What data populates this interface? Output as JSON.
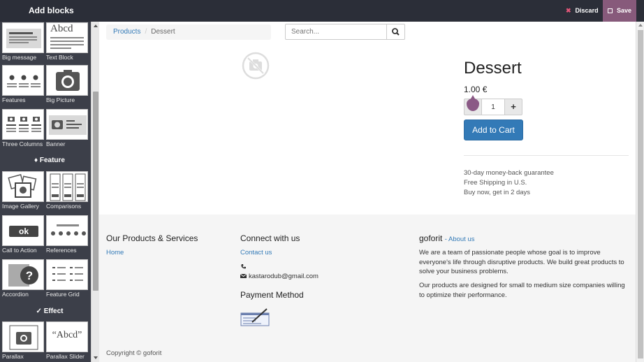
{
  "sidebar": {
    "title": "Add blocks",
    "snippets": [
      {
        "label": "Big message"
      },
      {
        "label": "Text Block"
      },
      {
        "label": "Features"
      },
      {
        "label": "Big Picture"
      },
      {
        "label": "Three Columns"
      },
      {
        "label": "Banner"
      },
      {
        "label": "Image Gallery"
      },
      {
        "label": "Comparisons"
      },
      {
        "label": "Call to Action"
      },
      {
        "label": "References"
      },
      {
        "label": "Accordion"
      },
      {
        "label": "Feature Grid"
      },
      {
        "label": "Parallax"
      },
      {
        "label": "Parallax Slider"
      }
    ],
    "sections": {
      "feature": "Feature",
      "effect": "Effect"
    },
    "thumb_text": {
      "text_block": "Abcd",
      "call_to_action": "ok",
      "parallax_slider": "Abcd"
    }
  },
  "toolbar": {
    "discard": "Discard",
    "save": "Save"
  },
  "breadcrumb": {
    "parent": "Products",
    "current": "Dessert"
  },
  "search": {
    "placeholder": "Search..."
  },
  "product": {
    "title": "Dessert",
    "price": "1.00 €",
    "quantity": "1",
    "add_to_cart": "Add to Cart",
    "terms": [
      "30-day money-back guarantee",
      "Free Shipping in U.S.",
      "Buy now, get in 2 days"
    ]
  },
  "footer": {
    "col1": {
      "title": "Our Products & Services",
      "link": "Home"
    },
    "col2": {
      "title": "Connect with us",
      "contact": "Contact us",
      "email": "kastarodub@gmail.com",
      "payment_title": "Payment Method"
    },
    "col3": {
      "brand": "goforit",
      "about": "About us",
      "p1": "We are a team of passionate people whose goal is to improve everyone's life through disruptive products. We build great products to solve your business problems.",
      "p2": "Our products are designed for small to medium size companies willing to optimize their performance."
    },
    "copyright": "Copyright © goforit"
  },
  "colors": {
    "accent": "#875a7b",
    "primary": "#337ab7",
    "sidebar": "#3c3f49",
    "topbar": "#2b2e38",
    "discard_x": "#e4577a"
  }
}
